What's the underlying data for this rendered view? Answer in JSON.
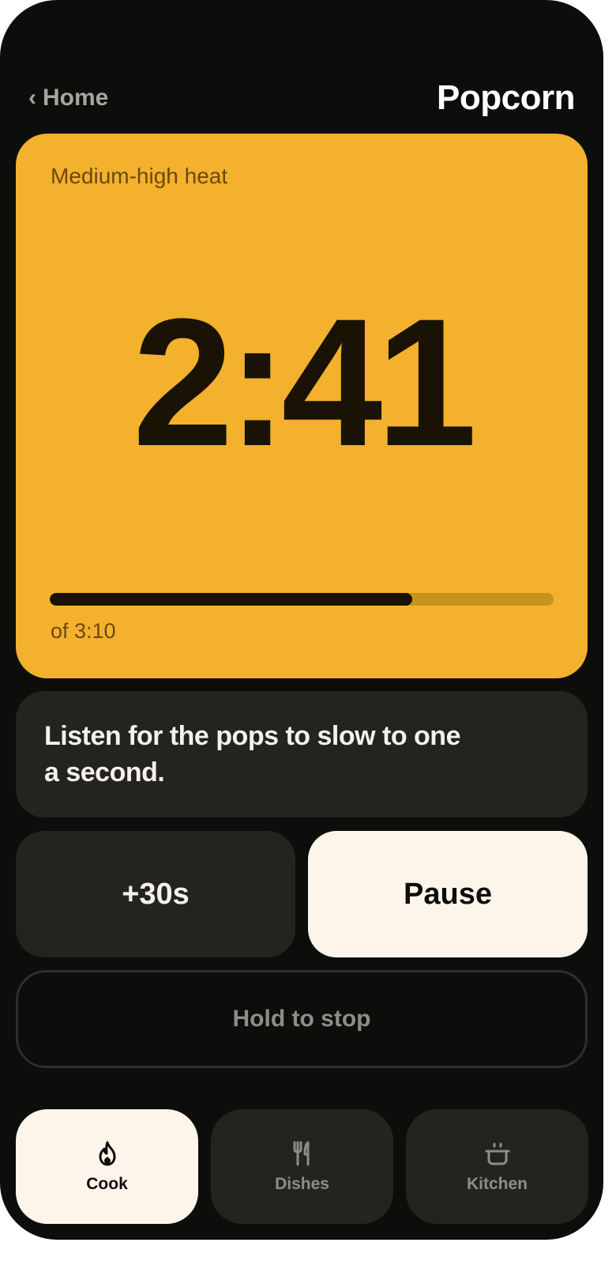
{
  "header": {
    "back_chevron": "‹",
    "back_label": "Home",
    "title": "Popcorn"
  },
  "timer": {
    "heat_label": "Medium-high heat",
    "remaining": "2:41",
    "total_label": "of 3:10",
    "progress_fraction": 0.72
  },
  "tip": {
    "text": "Listen for the pops to slow to one a second."
  },
  "controls": {
    "add_label": "+30s",
    "pause_label": "Pause",
    "stop_label": "Hold to stop"
  },
  "nav": {
    "items": [
      {
        "label": "Cook",
        "icon": "flame-icon",
        "active": true
      },
      {
        "label": "Dishes",
        "icon": "fork-knife-icon",
        "active": false
      },
      {
        "label": "Kitchen",
        "icon": "pot-icon",
        "active": false
      }
    ]
  },
  "colors": {
    "background": "#0d0d0c",
    "accent": "#f3b12d",
    "card": "#232320",
    "light": "#fdf5ea"
  }
}
